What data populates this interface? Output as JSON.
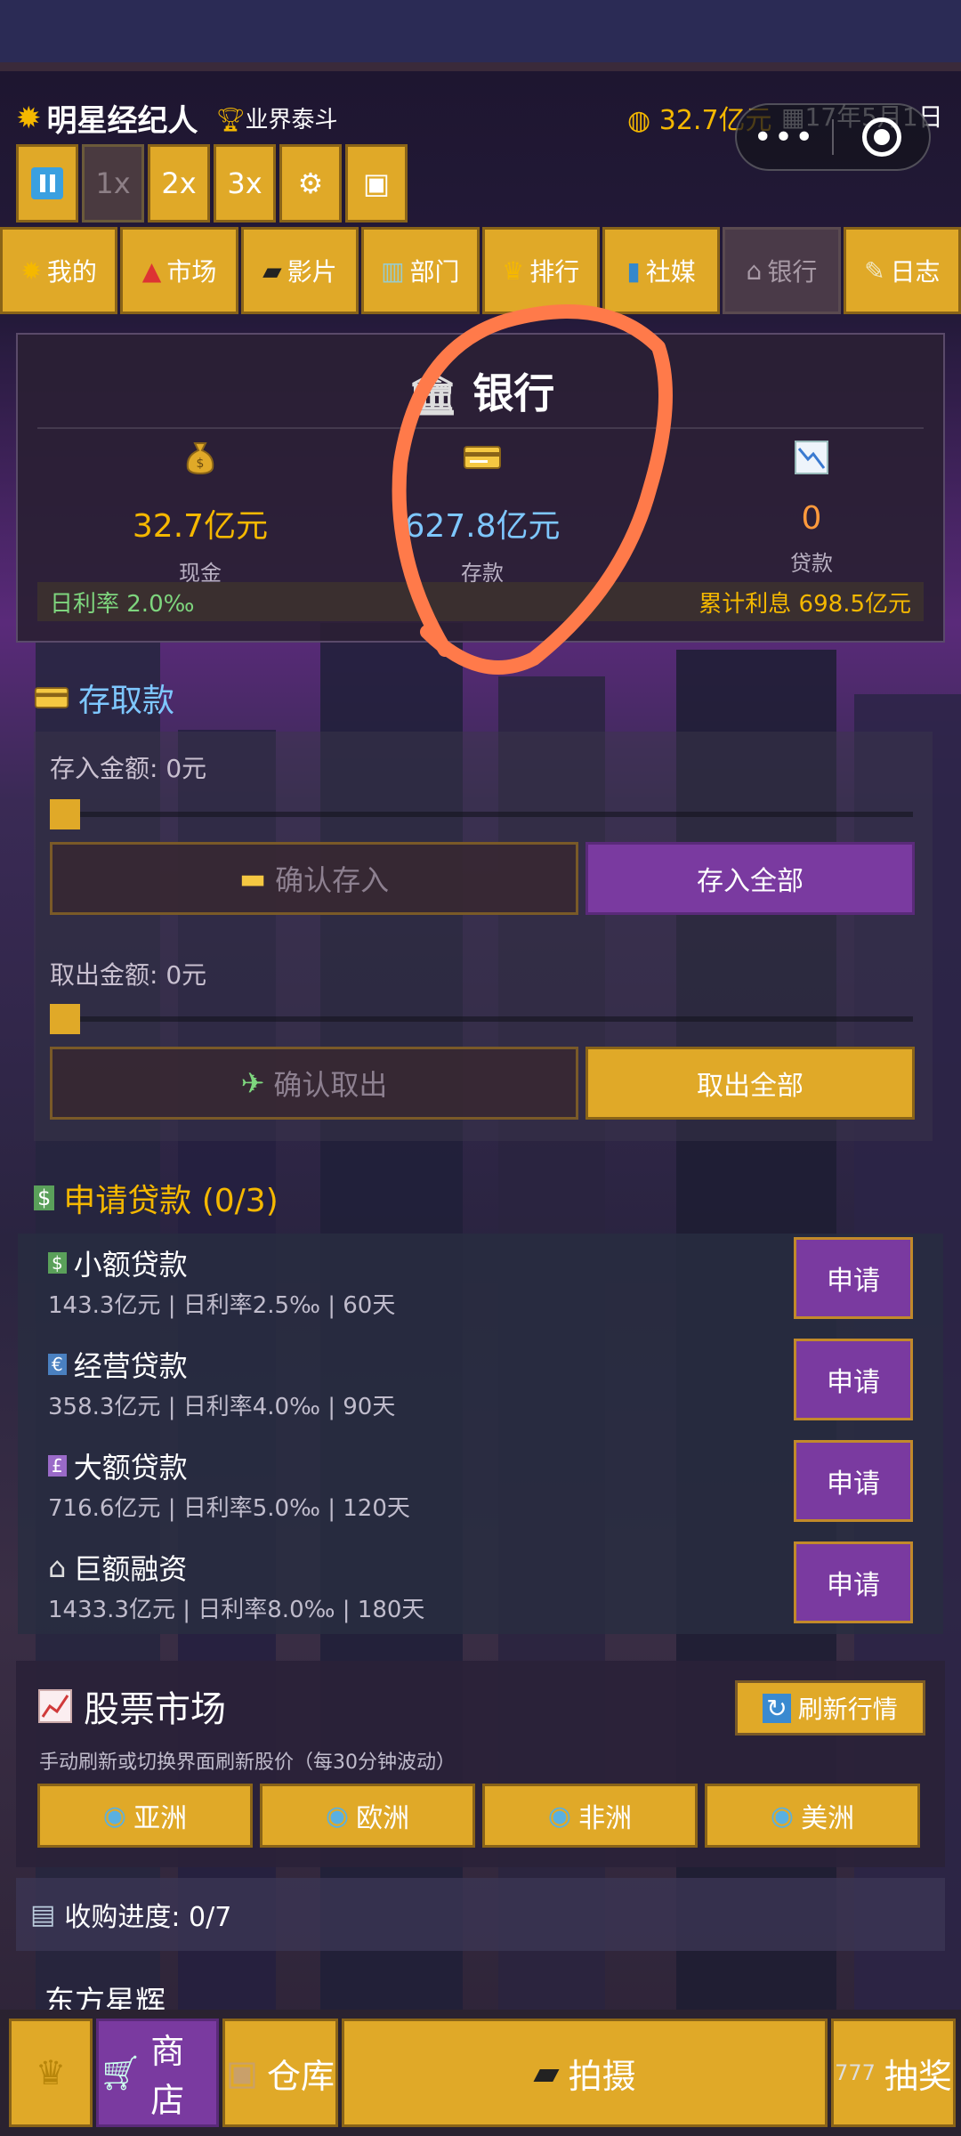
{
  "header": {
    "title": "明星经纪人",
    "rank": "业界泰斗",
    "cash": "32.7亿元",
    "date": "17年5月1日",
    "speed_buttons": [
      "1x",
      "2x",
      "3x"
    ]
  },
  "nav": {
    "tabs": [
      {
        "label": "我的",
        "icon": "sun-icon"
      },
      {
        "label": "市场",
        "icon": "circus-tent-icon"
      },
      {
        "label": "影片",
        "icon": "clapper-icon"
      },
      {
        "label": "部门",
        "icon": "office-icon"
      },
      {
        "label": "排行",
        "icon": "trophy-icon"
      },
      {
        "label": "社媒",
        "icon": "phone-icon"
      },
      {
        "label": "银行",
        "icon": "bank-icon",
        "active": true
      },
      {
        "label": "日志",
        "icon": "memo-icon"
      }
    ]
  },
  "bank": {
    "title": "银行",
    "cash_value": "32.7亿元",
    "cash_label": "现金",
    "deposit_value": "627.8亿元",
    "deposit_label": "存款",
    "loan_value": "0",
    "loan_label": "贷款",
    "daily_rate": "日利率 2.0‰",
    "total_interest": "累计利息 698.5亿元"
  },
  "deposit_withdraw": {
    "title": "存取款",
    "deposit_amount_label": "存入金额: 0元",
    "confirm_deposit": "确认存入",
    "deposit_all": "存入全部",
    "withdraw_amount_label": "取出金额: 0元",
    "confirm_withdraw": "确认取出",
    "withdraw_all": "取出全部",
    "deposit_slider_fraction": 0,
    "withdraw_slider_fraction": 0
  },
  "loans": {
    "title": "申请贷款 (0/3)",
    "apply_label": "申请",
    "items": [
      {
        "name": "小额贷款",
        "meta": "143.3亿元 | 日利率2.5‰ | 60天",
        "icon": "dollar-bill-icon"
      },
      {
        "name": "经营贷款",
        "meta": "358.3亿元 | 日利率4.0‰ | 90天",
        "icon": "euro-bill-icon"
      },
      {
        "name": "大额贷款",
        "meta": "716.6亿元 | 日利率5.0‰ | 120天",
        "icon": "pound-bill-icon"
      },
      {
        "name": "巨额融资",
        "meta": "1433.3亿元 | 日利率8.0‰ | 180天",
        "icon": "bank-icon"
      }
    ]
  },
  "stocks": {
    "title": "股票市场",
    "refresh": "刷新行情",
    "note": "手动刷新或切换界面刷新股价（每30分钟波动）",
    "regions": [
      "亚洲",
      "欧洲",
      "非洲",
      "美洲"
    ]
  },
  "acquisition": {
    "label": "收购进度: 0/7",
    "partial_item": "东方星辉"
  },
  "bottom": {
    "shop": "商店",
    "storage": "仓库",
    "shoot": "拍摄",
    "lottery": "抽奖"
  },
  "colors": {
    "gold": "#e0a928",
    "purple": "#7a3aa0",
    "annotation": "#ff7a4a"
  }
}
